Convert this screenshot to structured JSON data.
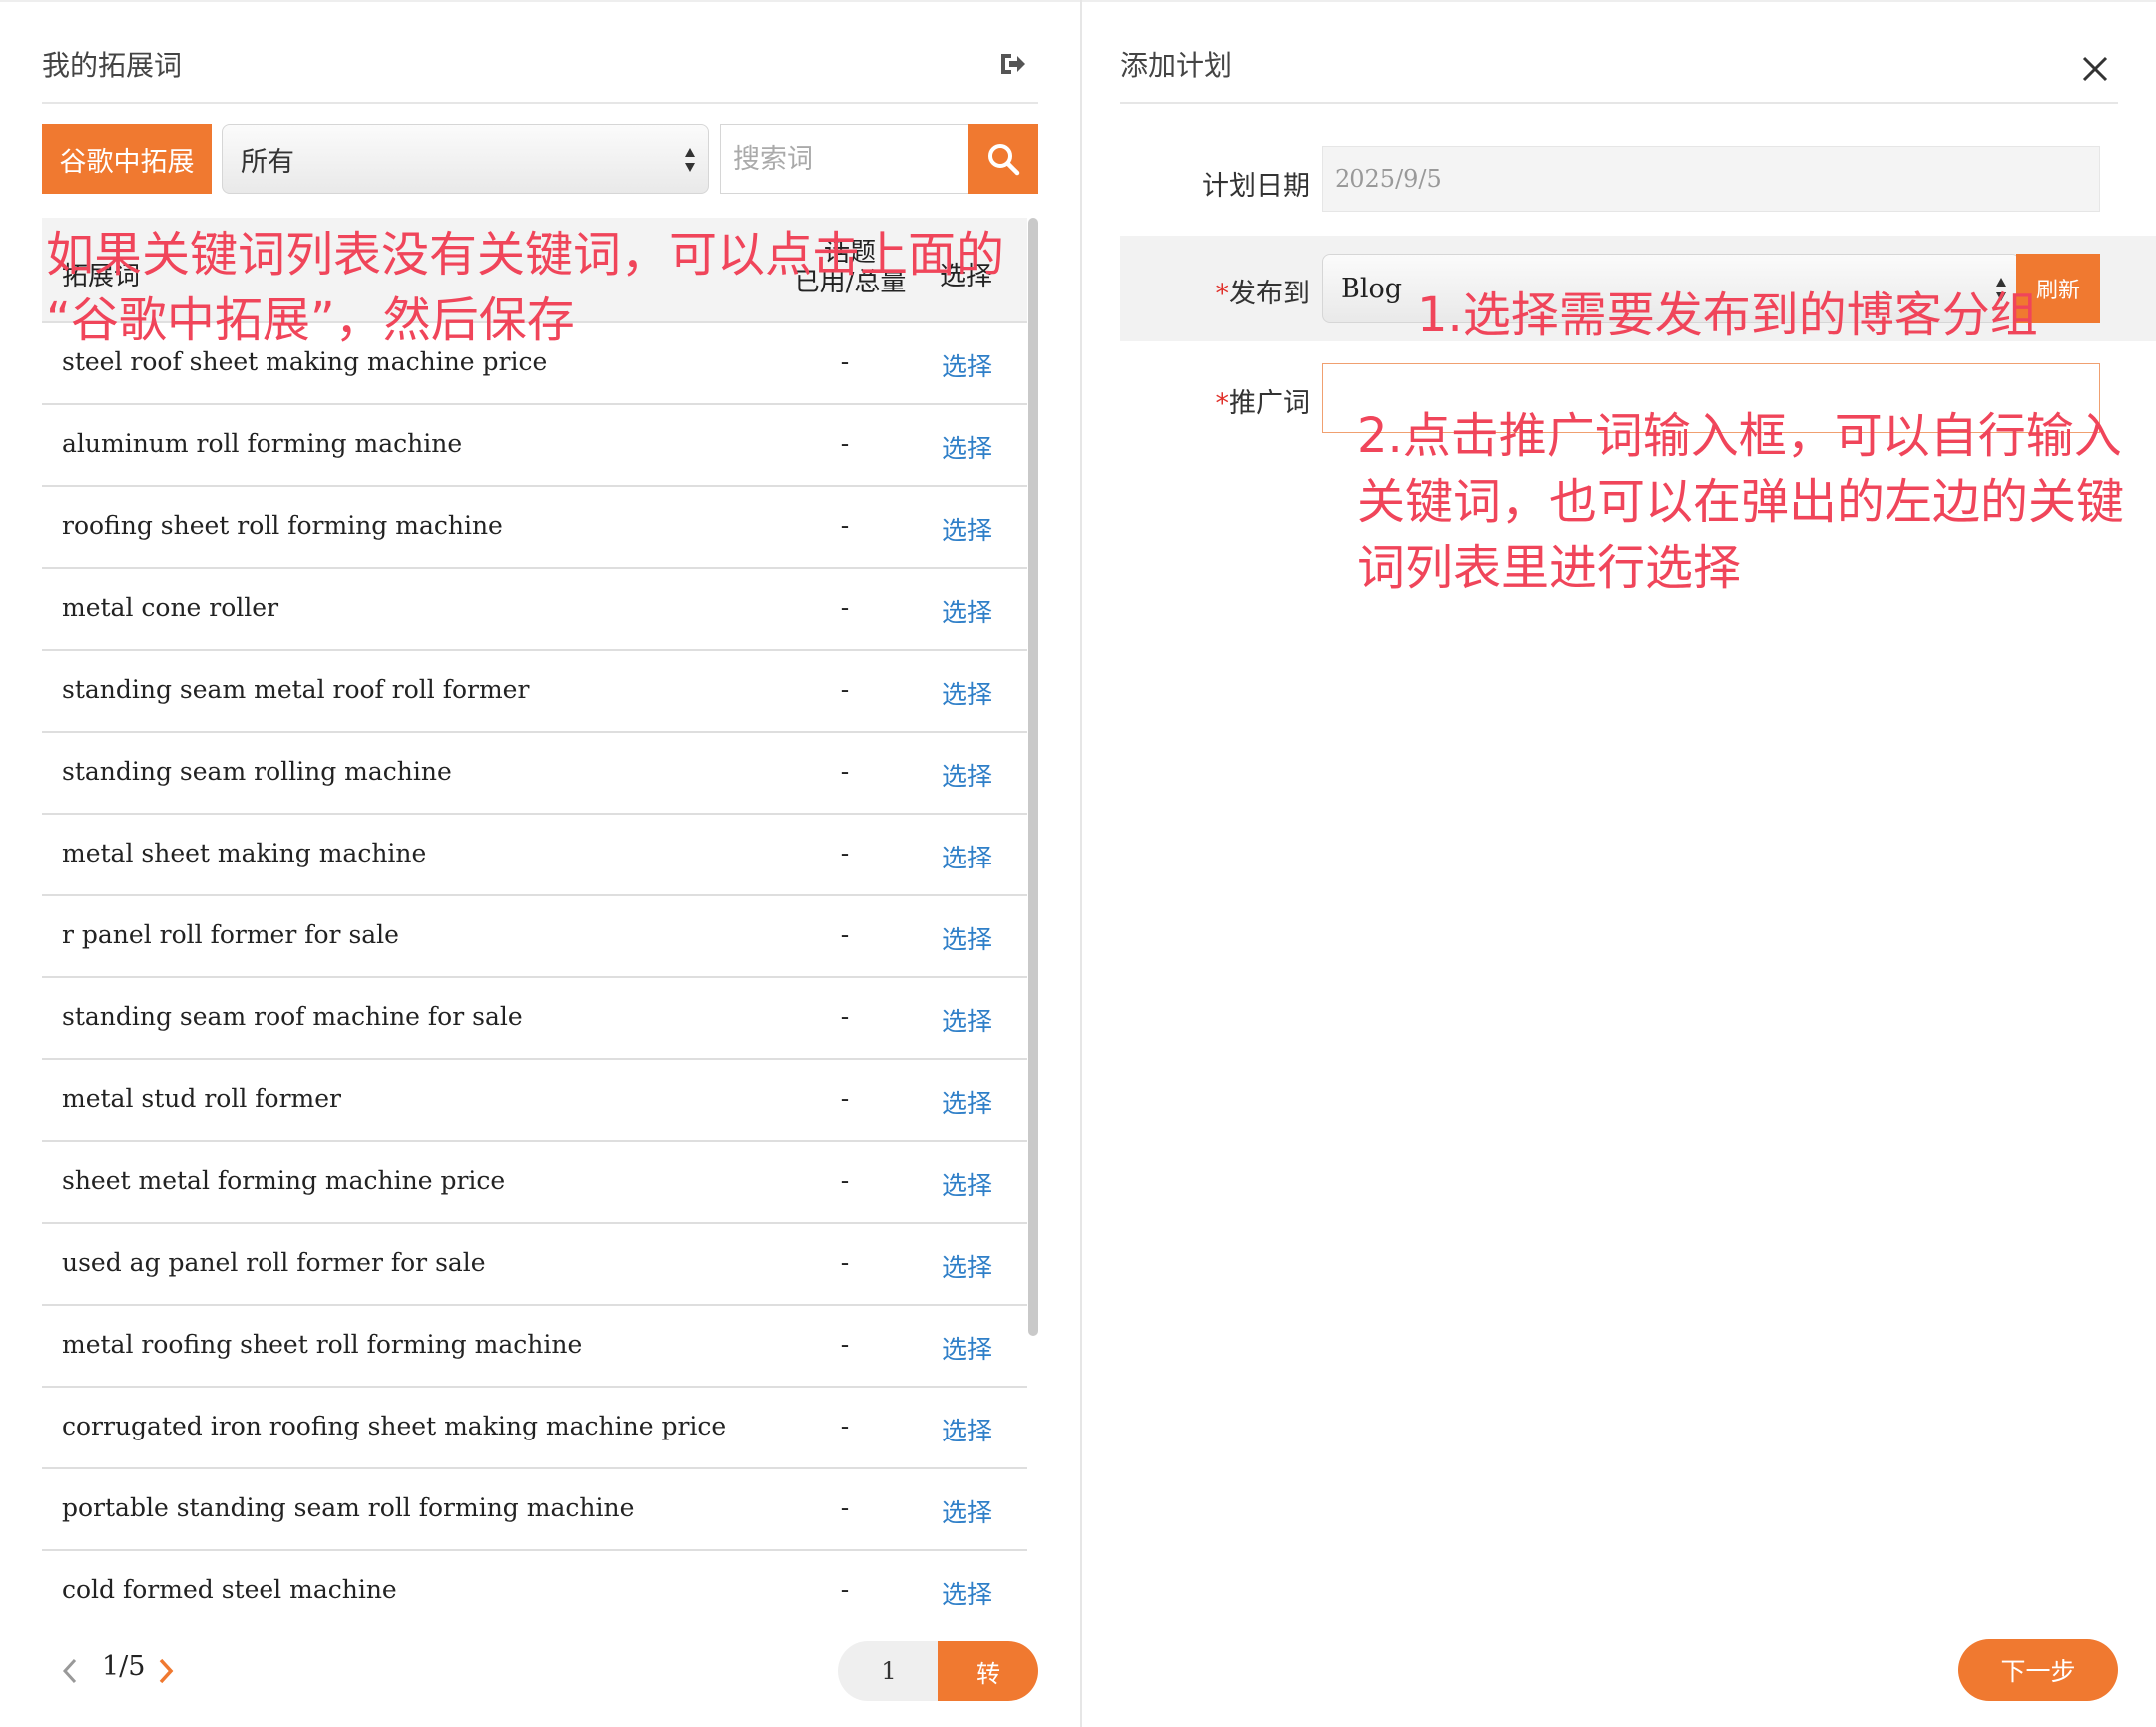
{
  "left_panel": {
    "title": "我的拓展词",
    "google_expand_label": "谷歌中拓展",
    "filter_selected": "所有",
    "search_placeholder": "搜索词",
    "table": {
      "col_keyword": "拓展词",
      "col_topic_line1": "话题",
      "col_topic_line2": "已用/总量",
      "col_select": "选择"
    },
    "rows": [
      {
        "keyword": "steel roof sheet making machine price",
        "count": "-",
        "action": "选择"
      },
      {
        "keyword": "aluminum roll forming machine",
        "count": "-",
        "action": "选择"
      },
      {
        "keyword": "roofing sheet roll forming machine",
        "count": "-",
        "action": "选择"
      },
      {
        "keyword": "metal cone roller",
        "count": "-",
        "action": "选择"
      },
      {
        "keyword": "standing seam metal roof roll former",
        "count": "-",
        "action": "选择"
      },
      {
        "keyword": "standing seam rolling machine",
        "count": "-",
        "action": "选择"
      },
      {
        "keyword": "metal sheet making machine",
        "count": "-",
        "action": "选择"
      },
      {
        "keyword": "r panel roll former for sale",
        "count": "-",
        "action": "选择"
      },
      {
        "keyword": "standing seam roof machine for sale",
        "count": "-",
        "action": "选择"
      },
      {
        "keyword": "metal stud roll former",
        "count": "-",
        "action": "选择"
      },
      {
        "keyword": "sheet metal forming machine price",
        "count": "-",
        "action": "选择"
      },
      {
        "keyword": "used ag panel roll former for sale",
        "count": "-",
        "action": "选择"
      },
      {
        "keyword": "metal roofing sheet roll forming machine",
        "count": "-",
        "action": "选择"
      },
      {
        "keyword": "corrugated iron roofing sheet making machine price",
        "count": "-",
        "action": "选择"
      },
      {
        "keyword": "portable standing seam roll forming machine",
        "count": "-",
        "action": "选择"
      },
      {
        "keyword": "cold formed steel machine",
        "count": "-",
        "action": "选择"
      }
    ],
    "pager": {
      "current": "1/5",
      "goto_value": "1",
      "goto_label": "转"
    },
    "annotation_line1": "如果关键词列表没有关键词，可以点击上面的",
    "annotation_line2": "“谷歌中拓展”，然后保存"
  },
  "right_panel": {
    "title": "添加计划",
    "date_label": "计划日期",
    "date_value": "2025/9/5",
    "publish_label": "发布到",
    "publish_value": "Blog",
    "refresh_label": "刷新",
    "keyword_label": "推广词",
    "required_mark": "*",
    "annotation1": "1.选择需要发布到的博客分组",
    "annotation2": "2.点击推广词输入框，可以自行输入关键词，也可以在弹出的左边的关键词列表里进行选择",
    "next_label": "下一步"
  },
  "colors": {
    "accent": "#f07930",
    "link": "#2f7fc8",
    "annotation": "#f0455a",
    "required": "#e0302a"
  },
  "icons": [
    "export-icon",
    "search-icon",
    "close-icon",
    "select-arrows-icon",
    "chevron-left-icon",
    "chevron-right-icon"
  ]
}
